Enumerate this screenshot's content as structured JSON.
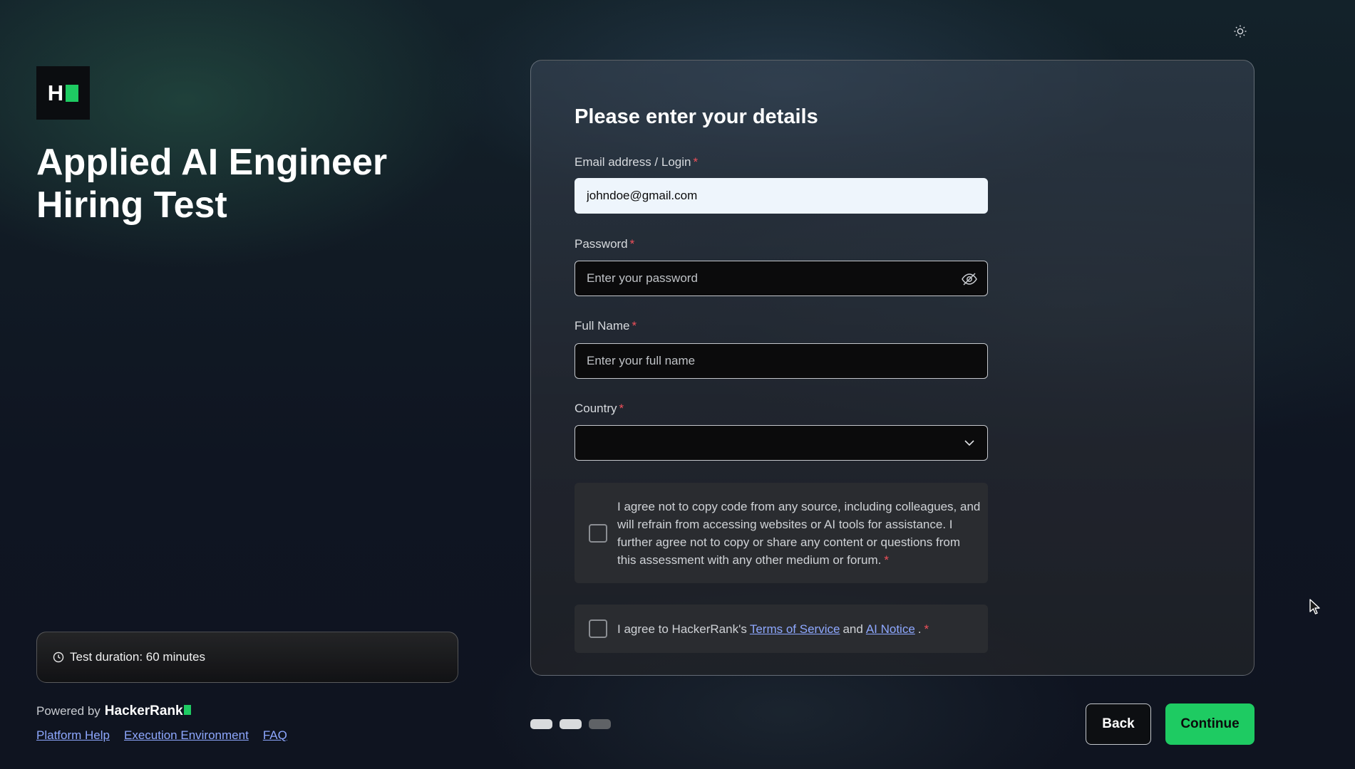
{
  "header": {
    "logo_letter": "H",
    "theme_icon": "sun-icon"
  },
  "test": {
    "title": "Applied AI Engineer Hiring Test",
    "duration_label": "Test duration: 60 minutes"
  },
  "footer": {
    "powered_by": "Powered by",
    "brand": "HackerRank",
    "links": [
      "Platform Help",
      "Execution Environment",
      "FAQ"
    ]
  },
  "form": {
    "title": "Please enter your details",
    "email": {
      "label": "Email address / Login",
      "value": "johndoe@gmail.com"
    },
    "password": {
      "label": "Password",
      "placeholder": "Enter your password"
    },
    "full_name": {
      "label": "Full Name",
      "placeholder": "Enter your full name"
    },
    "country": {
      "label": "Country",
      "value": ""
    },
    "required_mark": "*",
    "agree_copy": "I agree not to copy code from any source, including colleagues, and will refrain from accessing websites or AI tools for assistance. I further agree not to copy or share any content or questions from this assessment with any other medium or forum.",
    "agree_terms": {
      "prefix": "I agree to HackerRank's",
      "terms_link": "Terms of Service",
      "conjunction": "and",
      "notice_link": "AI Notice",
      "suffix": "."
    }
  },
  "progress": {
    "steps": 3,
    "current": 2
  },
  "buttons": {
    "back": "Back",
    "continue": "Continue"
  },
  "colors": {
    "accent": "#1ecb62",
    "link": "#8ea8ff",
    "required": "#f0505a"
  }
}
